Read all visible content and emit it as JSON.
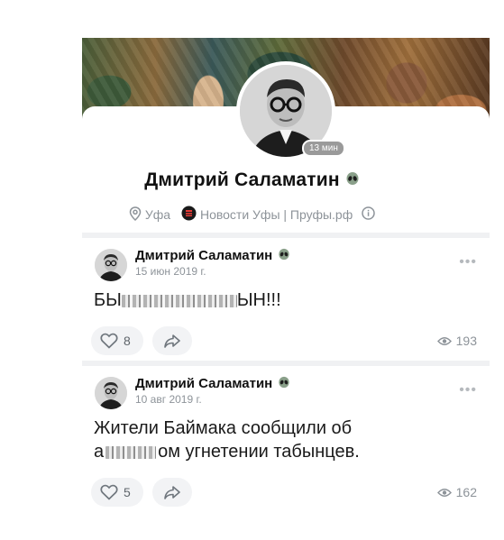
{
  "profile": {
    "name": "Дмитрий Саламатин",
    "online_badge": "13 мин",
    "city": "Уфа",
    "work": "Новости Уфы | Пруфы.рф"
  },
  "posts": [
    {
      "author": "Дмитрий Саламатин",
      "date": "15 июн 2019 г.",
      "text_start": "БЫ",
      "text_end": "ЫН!!!",
      "likes": "8",
      "views": "193"
    },
    {
      "author": "Дмитрий Саламатин",
      "date": "10 авг 2019 г.",
      "text_line1": "Жители Баймака сообщили об",
      "text_line2_start": "а",
      "text_line2_end": "ом угнетении табынцев.",
      "likes": "5",
      "views": "162"
    }
  ],
  "icons": {
    "alien": "alien-emoji-icon",
    "location": "location-pin-icon",
    "company": "company-logo-icon",
    "info": "info-icon",
    "more": "more-dots-icon",
    "like": "heart-icon",
    "share": "share-arrow-icon",
    "views": "eye-icon"
  },
  "colors": {
    "muted_text": "#8d9399",
    "pill_bg": "#f2f3f5",
    "badge_bg": "#9a9a9a"
  }
}
